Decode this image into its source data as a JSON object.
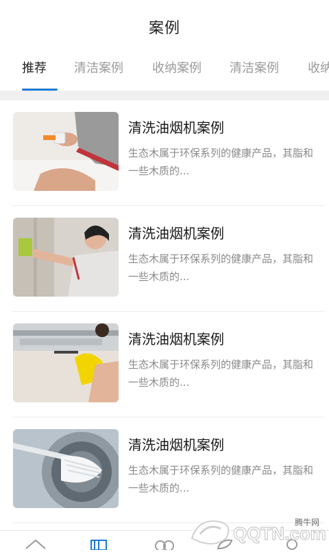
{
  "header": {
    "title": "案例"
  },
  "tabs": [
    {
      "label": "推荐",
      "active": true
    },
    {
      "label": "清洁案例",
      "active": false
    },
    {
      "label": "收纳案例",
      "active": false
    },
    {
      "label": "清洁案例",
      "active": false
    },
    {
      "label": "收纳",
      "active": false
    }
  ],
  "items": [
    {
      "title": "清洗油烟机案例",
      "desc": "生态木属于环保系列的健康产品，其脂和一些木质的...",
      "image": "spray-bottle-photo"
    },
    {
      "title": "清洗油烟机案例",
      "desc": "生态木属于环保系列的健康产品，其脂和一些木质的...",
      "image": "woman-wiping-cabinet-photo"
    },
    {
      "title": "清洗油烟机案例",
      "desc": "生态木属于环保系列的健康产品，其脂和一些木质的...",
      "image": "steam-cleaning-hood-photo"
    },
    {
      "title": "清洗油烟机案例",
      "desc": "生态木属于环保系列的健康产品，其脂和一些木质的...",
      "image": "brush-washing-machine-photo"
    }
  ],
  "bottom_nav": {
    "icons": [
      "home-icon",
      "cases-icon",
      "service-icon",
      "leaf-icon",
      "user-icon"
    ]
  },
  "watermark": {
    "brand": "腾牛网",
    "logo_text": "QQTN.com"
  },
  "colors": {
    "accent": "#1e78d6",
    "title_text": "#1a1a1a",
    "muted_text": "#8a8a8a"
  }
}
